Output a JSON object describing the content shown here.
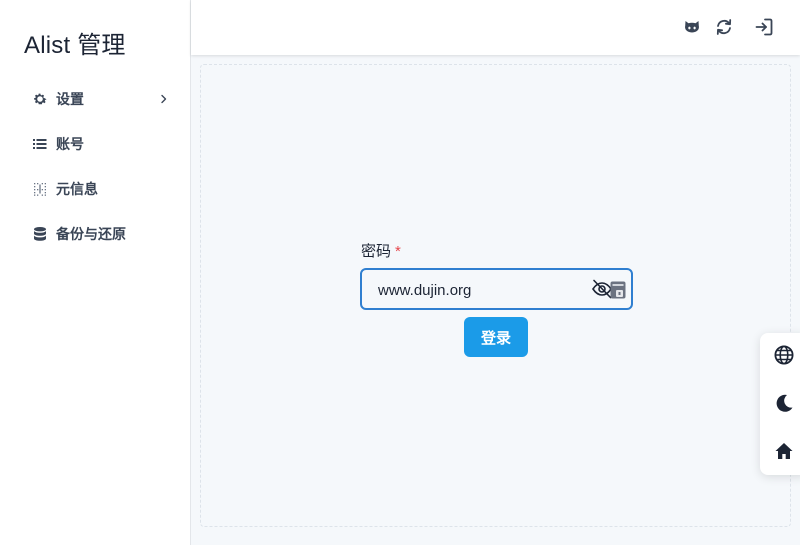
{
  "sidebar": {
    "title": "Alist 管理",
    "items": [
      {
        "label": "设置",
        "icon": "gear-icon",
        "has_submenu": true
      },
      {
        "label": "账号",
        "icon": "list-icon"
      },
      {
        "label": "元信息",
        "icon": "grid-dots-icon"
      },
      {
        "label": "备份与还原",
        "icon": "database-icon"
      }
    ]
  },
  "header": {
    "buttons": [
      {
        "icon": "github-icon"
      },
      {
        "icon": "refresh-icon"
      },
      {
        "icon": "logout-icon"
      }
    ]
  },
  "login_form": {
    "password_label": "密码",
    "required_mark": "*",
    "password_value": "www.dujin.org",
    "submit_label": "登录"
  },
  "float_panel": {
    "buttons": [
      {
        "icon": "globe-icon"
      },
      {
        "icon": "moon-icon"
      },
      {
        "icon": "home-icon"
      }
    ]
  },
  "colors": {
    "accent": "#1b9be8",
    "input_border": "#2f7fd0",
    "required": "#e5484d",
    "text_primary": "#1c2434",
    "background": "#f5f8fb"
  }
}
